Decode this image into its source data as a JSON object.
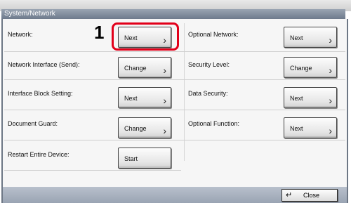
{
  "window": {
    "title": "System/Network"
  },
  "marker": "1",
  "rows_left": [
    {
      "label": "Network:",
      "button": "Next",
      "chevron": true
    },
    {
      "label": "Network Interface (Send):",
      "button": "Change",
      "chevron": true
    },
    {
      "label": "Interface Block Setting:",
      "button": "Next",
      "chevron": true
    },
    {
      "label": "Document Guard:",
      "button": "Change",
      "chevron": true
    },
    {
      "label": "Restart Entire Device:",
      "button": "Start",
      "chevron": false
    }
  ],
  "rows_right": [
    {
      "label": "Optional Network:",
      "button": "Next",
      "chevron": true
    },
    {
      "label": "Security Level:",
      "button": "Change",
      "chevron": true
    },
    {
      "label": "Data Security:",
      "button": "Next",
      "chevron": true
    },
    {
      "label": "Optional Function:",
      "button": "Next",
      "chevron": true
    }
  ],
  "footer": {
    "close_label": "Close",
    "close_icon": "return-arrow-icon"
  },
  "colors": {
    "highlight": "#e2001a",
    "title_bar": "#7b8697"
  }
}
